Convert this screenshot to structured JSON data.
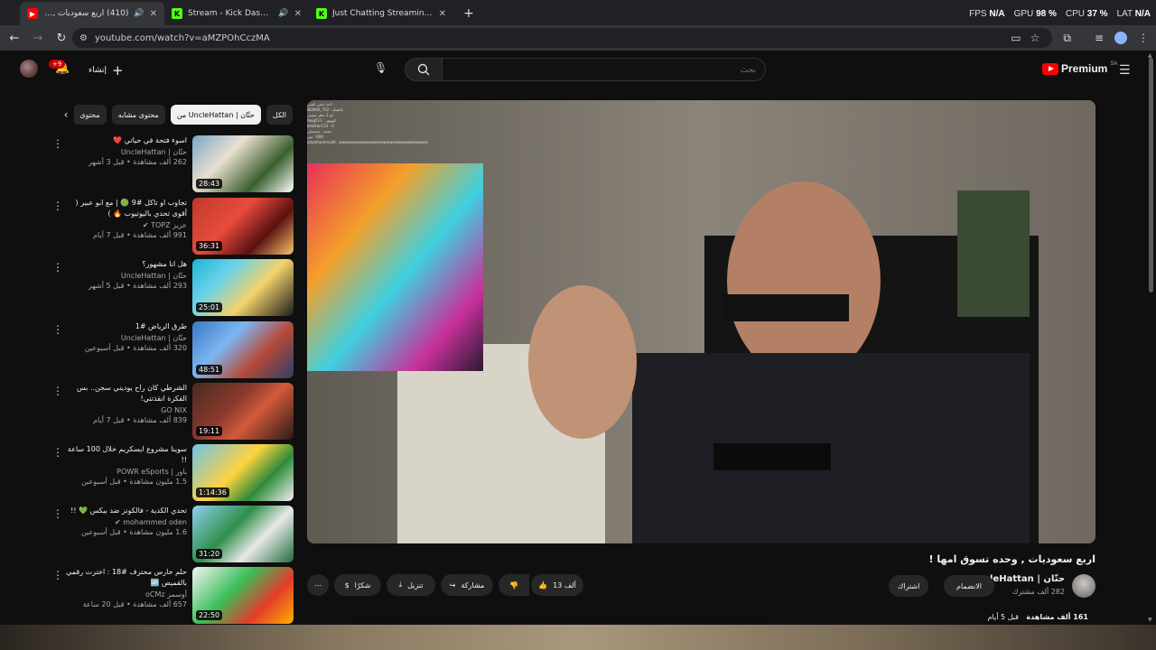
{
  "browser": {
    "tabs": [
      {
        "title": "(410) اربع سعوديات , وحده تسوق امها !",
        "active": true
      },
      {
        "title": "Stream - Kick Dashboard",
        "active": false
      },
      {
        "title": "Just Chatting Streaming - Live",
        "active": false
      }
    ],
    "url": "youtube.com/watch?v=aMZPOhCczMA",
    "perf": {
      "fps_label": "FPS",
      "fps_value": "N/A",
      "gpu_label": "GPU",
      "gpu_value": "98 %",
      "cpu_label": "CPU",
      "cpu_value": "37 %",
      "lat_label": "LAT",
      "lat_value": "N/A"
    }
  },
  "header": {
    "logo_text": "Premium",
    "logo_region": "SA",
    "search_placeholder": "بحث",
    "create_label": "إنشاء",
    "notif_badge": "+9"
  },
  "chips": [
    {
      "label": "الكل",
      "active": false
    },
    {
      "label": "من UncleHattan | حتّان",
      "active": true
    },
    {
      "label": "محتوى مشابه",
      "active": false
    },
    {
      "label": "محتوى",
      "active": false
    }
  ],
  "recommendations": [
    {
      "title": "اسوء فتحة في حياتي ❤️",
      "channel": "حتّان | UncleHattan",
      "meta": "262 ألف مشاهدة • قبل 3 أشهر",
      "duration": "28:43"
    },
    {
      "title": "تجاوب او تاكل #9 🟢 | مع ابو عبير ( أقوى تحدي باليوتيوب 🔥 )",
      "channel": "عزيز TOPZ ✔",
      "meta": "991 ألف مشاهدة • قبل 7 أيام",
      "duration": "36:31"
    },
    {
      "title": "هل انا مشهور؟",
      "channel": "حتّان | UncleHattan",
      "meta": "293 ألف مشاهدة • قبل 5 أشهر",
      "duration": "25:01"
    },
    {
      "title": "طرق الرياض #1",
      "channel": "حتّان | UncleHattan",
      "meta": "320 ألف مشاهدة • قبل أسبوعين",
      "duration": "48:51"
    },
    {
      "title": "الشرطي كان راح يوديني سجن.. بس الفكرة انقذتني!",
      "channel": "GO NIX",
      "meta": "839 ألف مشاهدة • قبل 7 أيام",
      "duration": "19:11"
    },
    {
      "title": "سوينا مشروع ايسكريم خلال 100 ساعة !!",
      "channel": "باور | POWR eSports",
      "meta": "1.5 مليون مشاهدة • قبل أسبوعين",
      "duration": "1:14:36"
    },
    {
      "title": "تحدي الكدية - فالكونز ضد بيكس 💚 !!",
      "channel": "mohammed oden ✔",
      "meta": "1.6 مليون مشاهدة • قبل أسبوعين",
      "duration": "31:20"
    },
    {
      "title": "حلم حارس محترف #18 : اخترت رقمي بالقميص 🆙",
      "channel": "أوسمز oCMz",
      "meta": "657 ألف مشاهدة • قبل 20 ساعة",
      "duration": "22:50"
    }
  ],
  "video": {
    "title": "اربع سعوديات , وحده تسوق امها !",
    "channel_name": "حتّان | UncleHattan",
    "subscribers": "282 ألف مشترك",
    "join_label": "الانضمام",
    "subscribe_label": "اشتراك",
    "likes": "13 ألف",
    "share_label": "مشاركة",
    "download_label": "تنزيل",
    "thanks_label": "شكرًا",
    "views": "161 ألف مشاهدة",
    "age": "قبل 5 أيام",
    "chat_lines": [
      "لاحد ياشي الشي",
      "NGNAR_702 : بالشيلة",
      "ابو 1 ماهر عجبني",
      "teeg511 : كووووز",
      "ahattan123 : V",
      "محمد : تسمحلي",
      "مين : KIKI",
      "adamhammod6 : wwwwwwwwwwwwwwwwwwwwwwwwwwwwww"
    ]
  },
  "colors": {
    "brand_red": "#ff0000",
    "bg": "#0f0f0f",
    "chip_bg": "#272727"
  }
}
